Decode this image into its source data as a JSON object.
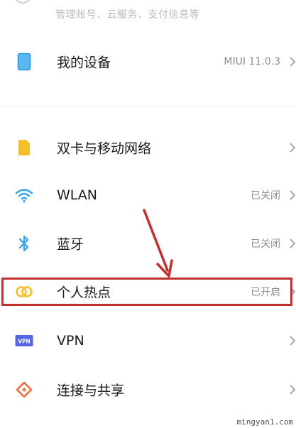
{
  "header": {
    "account_subtitle": "管理账号、云服务、支付信息等"
  },
  "rows": [
    {
      "name": "my-device",
      "label": "我的设备",
      "value": "MIUI 11.0.3",
      "icon": "phone-icon",
      "color": "#3fa7e8"
    },
    {
      "name": "dual-sim",
      "label": "双卡与移动网络",
      "value": "",
      "icon": "sim-card-icon",
      "color": "#f6bf26"
    },
    {
      "name": "wlan",
      "label": "WLAN",
      "value": "已关闭",
      "icon": "wifi-icon",
      "color": "#3fa7e8"
    },
    {
      "name": "bluetooth",
      "label": "蓝牙",
      "value": "已关闭",
      "icon": "bluetooth-icon",
      "color": "#3fa7e8"
    },
    {
      "name": "hotspot",
      "label": "个人热点",
      "value": "已开启",
      "icon": "hotspot-icon",
      "color": "#f6bf26"
    },
    {
      "name": "vpn",
      "label": "VPN",
      "value": "",
      "icon": "vpn-icon",
      "color": "#5566e0"
    },
    {
      "name": "connection-sharing",
      "label": "连接与共享",
      "value": "",
      "icon": "share-icon",
      "color": "#f06a3b"
    }
  ],
  "vpn_badge_text": "VPN",
  "annotation_color": "#c0302f",
  "watermark": "mingyan1.com"
}
